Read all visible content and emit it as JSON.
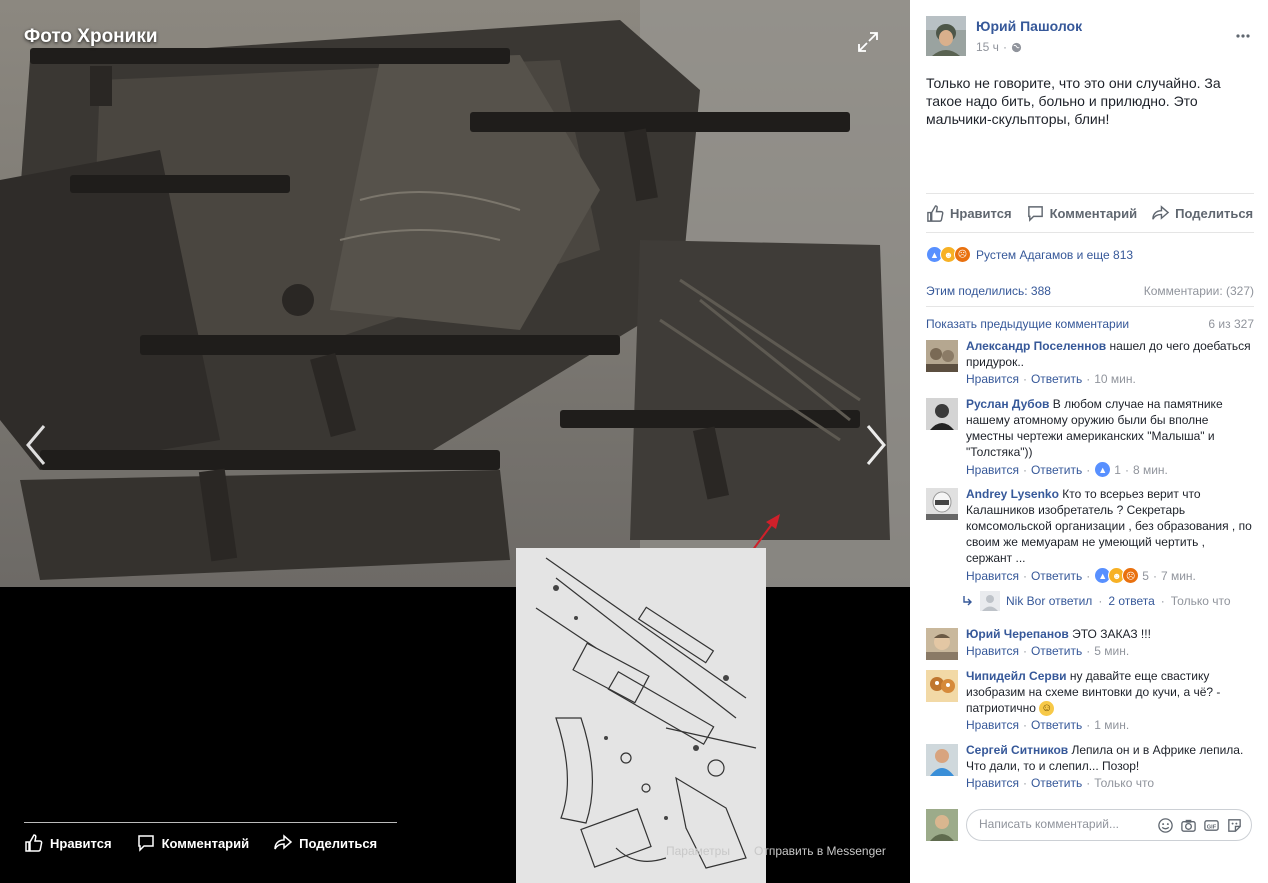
{
  "theater": {
    "title": "Фото Хроники",
    "actions": {
      "like": "Нравится",
      "comment": "Комментарий",
      "share": "Поделиться"
    },
    "params": "Параметры",
    "messenger": "Отправить в Messenger"
  },
  "post": {
    "author": "Юрий Пашолок",
    "time": "15 ч",
    "separator": "·",
    "text": "Только не говорите, что это они случайно. За такое надо бить, больно и прилюдно. Это мальчики-скульпторы, блин!",
    "actions": {
      "like": "Нравится",
      "comment": "Комментарий",
      "share": "Поделиться"
    },
    "reactions_text": "Рустем Адагамов и еще 813",
    "shares": "Этим поделились: 388",
    "comments_count": "Комментарии: (327)",
    "show_previous": "Показать предыдущие комментарии",
    "comment_position": "6 из 327"
  },
  "comment_ui": {
    "like": "Нравится",
    "reply": "Ответить",
    "dot": "·"
  },
  "comments": [
    {
      "author": "Александр Поселеннов",
      "text": "нашел до чего доебаться придурок..",
      "time": "10 мин.",
      "likes": ""
    },
    {
      "author": "Руслан Дубов",
      "text": "В любом случае на памятнике нашему атомному оружию были бы вполне уместны чертежи американских \"Малыша\" и \"Толстяка\"))",
      "time": "8 мин.",
      "likes": "1"
    },
    {
      "author": "Andrey Lysenko",
      "text": "Кто то всерьез верит что Калашников изобретатель ? Секретарь комсомольской организации , без образования , по своим же мемуарам не умеющий чертить , сержант ...",
      "time": "7 мин.",
      "likes": "5"
    },
    {
      "author": "Юрий Черепанов",
      "text": "ЭТО ЗАКАЗ !!!",
      "time": "5 мин.",
      "likes": ""
    },
    {
      "author": "Чипидейл Серви",
      "text": "ну давайте еще свастику изобразим на схеме винтовки до кучи, а чё? - патриотично",
      "time": "1 мин.",
      "likes": ""
    },
    {
      "author": "Сергей Ситников",
      "text": "Лепила он и в Африке лепила. Что дали, то и слепил... Позор!",
      "time": "Только что",
      "likes": ""
    }
  ],
  "reply": {
    "author": "Nik Bor",
    "action": "ответил",
    "count": "2 ответа",
    "time": "Только что"
  },
  "write_comment": {
    "placeholder": "Написать комментарий..."
  },
  "colors": {
    "link": "#365899",
    "meta": "#90949c",
    "like_blue": "#5890ff",
    "reaction_haha": "#f7b125",
    "reaction_angry": "#e9710f"
  }
}
